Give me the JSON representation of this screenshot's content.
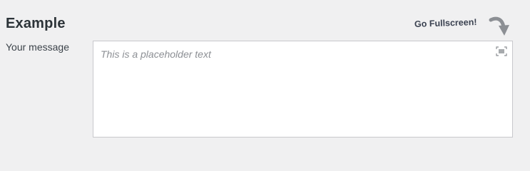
{
  "section": {
    "title": "Example"
  },
  "field": {
    "label": "Your message",
    "placeholder": "This is a placeholder text",
    "value": ""
  },
  "callout": {
    "text": "Go Fullscreen!",
    "icon": "curved-arrow-down-icon"
  },
  "editor": {
    "fullscreen_icon": "fullscreen-icon"
  },
  "colors": {
    "background": "#f0f0f1",
    "title": "#2c3338",
    "callout_text": "#3a4150",
    "arrow": "#8c8f94",
    "placeholder": "#8c8f94",
    "border": "#c8c8cc"
  }
}
